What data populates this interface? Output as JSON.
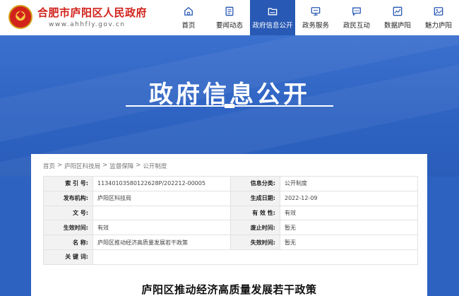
{
  "header": {
    "site_title": "合肥市庐阳区人民政府",
    "site_url": "www.ahhfly.gov.cn"
  },
  "nav": {
    "items": [
      {
        "label": "首页",
        "icon": "home-icon"
      },
      {
        "label": "要闻动态",
        "icon": "news-icon"
      },
      {
        "label": "政府信息公开",
        "icon": "folder-icon",
        "active": true
      },
      {
        "label": "政务服务",
        "icon": "monitor-icon"
      },
      {
        "label": "政民互动",
        "icon": "chat-icon"
      },
      {
        "label": "数据庐阳",
        "icon": "chart-icon"
      },
      {
        "label": "魅力庐阳",
        "icon": "picture-icon"
      }
    ]
  },
  "banner": {
    "title": "政府信息公开"
  },
  "breadcrumb": [
    "首页",
    "庐阳区科技局",
    "监督保障",
    "公开制度"
  ],
  "breadcrumb_separator": ">",
  "meta": {
    "index_no_label": "索 引 号:",
    "index_no": "11340103580122628P/202212-00005",
    "category_label": "信息分类:",
    "category": "公开制度",
    "publisher_label": "发布机构:",
    "publisher": "庐阳区科技局",
    "created_label": "生成日期:",
    "created": "2022-12-09",
    "doc_no_label": "文  号:",
    "doc_no": "",
    "validity_label": "有 效 性:",
    "validity": "有效",
    "effective_label": "生效时间:",
    "effective": "有效",
    "repeal_label": "废止时间:",
    "repeal": "暂无",
    "name_label": "名  称:",
    "name": "庐阳区推动经济高质量发展若干政策",
    "expire_label": "失效时间:",
    "expire": "暂无",
    "keywords_label": "关 键 词:",
    "keywords": ""
  },
  "document": {
    "title": "庐阳区推动经济高质量发展若干政策"
  },
  "colors": {
    "brand_red": "#d1221b",
    "nav_active": "#2859b4",
    "banner_blue": "#2e63c2"
  }
}
